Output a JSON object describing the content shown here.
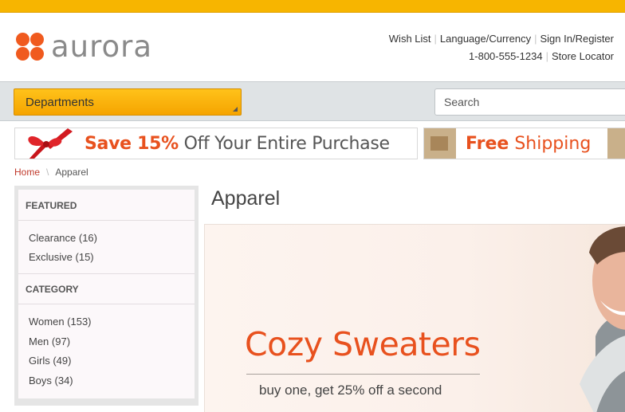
{
  "header": {
    "logo_text": "aurora",
    "links_row1": [
      "Wish List",
      "Language/Currency",
      "Sign In/Register"
    ],
    "phone": "1-800-555-1234",
    "store_locator": "Store Locator"
  },
  "nav": {
    "departments_label": "Departments",
    "search_placeholder": "Search"
  },
  "promos": {
    "save_prefix": "Save 15%",
    "save_rest": "Off Your Entire Purchase",
    "shipping_bold": "Free",
    "shipping_rest": "Shipping"
  },
  "breadcrumb": {
    "home": "Home",
    "current": "Apparel"
  },
  "sidebar": {
    "featured_heading": "FEATURED",
    "featured_items": [
      "Clearance (16)",
      "Exclusive (15)"
    ],
    "category_heading": "CATEGORY",
    "category_items": [
      "Women (153)",
      "Men (97)",
      "Girls (49)",
      "Boys (34)"
    ]
  },
  "main": {
    "title": "Apparel",
    "hero_title": "Cozy Sweaters",
    "hero_subtitle": "buy one, get 25% off a second"
  },
  "colors": {
    "accent_orange": "#e8511e",
    "topbar_yellow": "#f7b500",
    "link_red": "#c0392b"
  }
}
